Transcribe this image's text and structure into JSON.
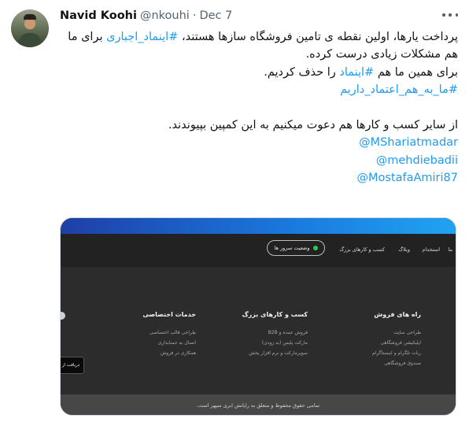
{
  "tweet": {
    "author_name": "Navid Koohi",
    "handle": "@nkouhi",
    "separator": "·",
    "date": "Dec 7",
    "more_icon": "more-horizontal-icon",
    "line1_pre": "پرداخت یارها، اولین نقطه ی تامین فروشگاه سازها هستند،  ",
    "line1_tag": "#اینماد_اجباری",
    "line1_post": " برای ما",
    "line2": "هم مشکلات زیادی درست کرده.",
    "line3_pre": "برای همین ما هم ",
    "line3_tag": "#اینماد",
    "line3_post": " را حذف کردیم.",
    "line4_tag": "#ما_به_هم_اعتماد_داریم",
    "line5": "از سایر کسب و کارها هم دعوت میکنیم به این کمپین بپیوندند.",
    "mentions": [
      "@MShariatmadar",
      "@mehdiebadii",
      "@MostafaAmiri87"
    ]
  },
  "media": {
    "nav": {
      "items": [
        "ما",
        "استخدام",
        "وبلاگ",
        "کسب و کارهای بزرگ"
      ],
      "server_status_label": "وضعیت سرور ها"
    },
    "columns": [
      {
        "title": "راه های فروش",
        "items": [
          "طراحی سایت",
          "اپلیکیشن فروشگاهی",
          "ربات تلگرام و اینستاگرام",
          "صندوق فروشگاهی"
        ]
      },
      {
        "title": "کسب و کارهای بزرگ",
        "items": [
          "فروش عمده و B2B",
          "مارکت پلیس (به زودی)",
          "سوپرمارکت و نرم افزار پخش"
        ]
      },
      {
        "title": "خدمات اختصاصی",
        "items": [
          "طراحی قالب اختصاصی",
          "اتصال به حسابداری",
          "همکاری در فروش"
        ]
      }
    ],
    "cta_label": "دریافت از",
    "footer": "تمامی حقوق محفوظ و متعلق به رایانش ابری سپهر است."
  },
  "colors": {
    "link": "#1d9bf0",
    "muted": "#536471",
    "site_dark": "#2c2c2c",
    "status_green": "#30c35a"
  }
}
